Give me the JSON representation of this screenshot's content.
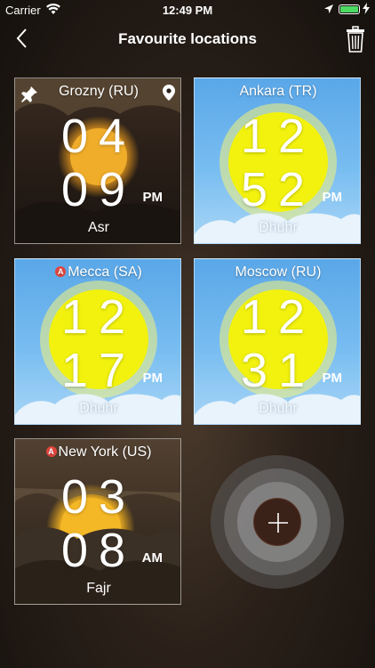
{
  "status_bar": {
    "carrier": "Carrier",
    "time": "12:49 PM"
  },
  "nav": {
    "title": "Favourite locations"
  },
  "icons": {
    "back": "chevron-left-icon",
    "trash": "trash-icon",
    "pin": "pin-icon",
    "location_marker": "map-marker-icon",
    "auto_badge": "auto-location-badge"
  },
  "auto_badge_letter": "A",
  "colors": {
    "day_sky": "#5aa7e8",
    "sun": "#f2f20e",
    "night_bg": "#2a1f18",
    "add_button": "#3b2218"
  },
  "locations": [
    {
      "name": "Grozny (RU)",
      "hours": "04",
      "minutes": "09",
      "ampm": "PM",
      "prayer": "Asr",
      "theme": "night"
    },
    {
      "name": "Ankara (TR)",
      "hours": "12",
      "minutes": "52",
      "ampm": "PM",
      "prayer": "Dhuhr",
      "theme": "day"
    },
    {
      "name": "Mecca (SA)",
      "hours": "12",
      "minutes": "17",
      "ampm": "PM",
      "prayer": "Dhuhr",
      "theme": "day"
    },
    {
      "name": "Moscow (RU)",
      "hours": "12",
      "minutes": "31",
      "ampm": "PM",
      "prayer": "Dhuhr",
      "theme": "day"
    },
    {
      "name": "New York (US)",
      "hours": "03",
      "minutes": "08",
      "ampm": "AM",
      "prayer": "Fajr",
      "theme": "dawn"
    }
  ],
  "add_button": {
    "icon": "plus-icon"
  }
}
